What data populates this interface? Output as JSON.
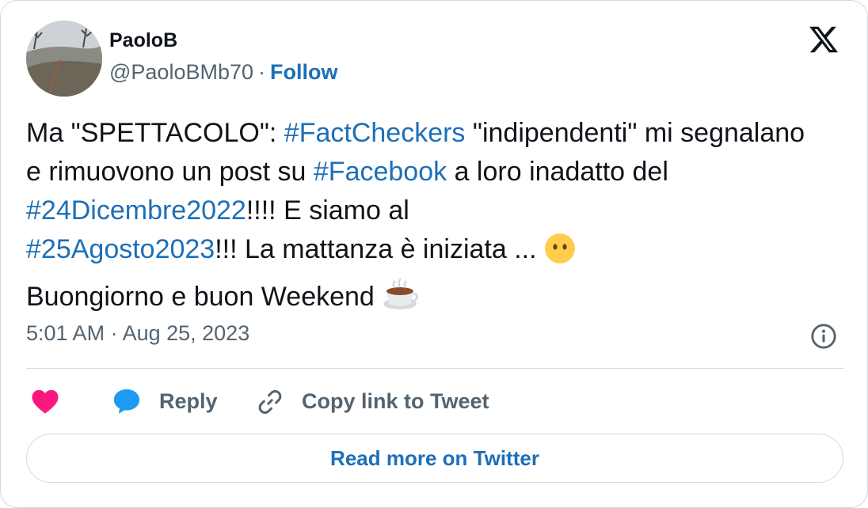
{
  "author": {
    "name": "PaoloB",
    "handle": "@PaoloBMb70",
    "separator": "·",
    "follow_label": "Follow"
  },
  "tweet": {
    "segments": [
      {
        "text": "Ma \"SPETTACOLO\": ",
        "type": "text"
      },
      {
        "text": "#FactCheckers",
        "type": "hashtag"
      },
      {
        "text": " \"indipendenti\" mi segnalano e rimuovono un post su ",
        "type": "text"
      },
      {
        "text": "#Facebook",
        "type": "hashtag"
      },
      {
        "text": " a loro inadatto del ",
        "type": "text"
      },
      {
        "text": "#24Dicembre2022",
        "type": "hashtag"
      },
      {
        "text": "!!!! E siamo al ",
        "type": "text"
      },
      {
        "text": "#25Agosto2023",
        "type": "hashtag"
      },
      {
        "text": "!!! La mattanza è iniziata  ... ",
        "type": "text"
      },
      {
        "text": "face-without-mouth",
        "type": "emoji"
      },
      {
        "text": " Buongiorno e buon Weekend ",
        "type": "text"
      },
      {
        "text": "hot-beverage",
        "type": "emoji"
      }
    ],
    "timestamp": "5:01 AM · Aug 25, 2023"
  },
  "actions": {
    "reply_label": "Reply",
    "copy_label": "Copy link to Tweet",
    "read_more_label": "Read more on Twitter"
  },
  "icons": {
    "logo": "x-logo-icon",
    "info": "info-icon",
    "like": "heart-icon",
    "reply": "speech-bubble-icon",
    "copy": "link-icon"
  },
  "colors": {
    "link": "#1d6fb8",
    "heart": "#f91880",
    "secondary_text": "#536471",
    "border": "#cfd9de"
  }
}
